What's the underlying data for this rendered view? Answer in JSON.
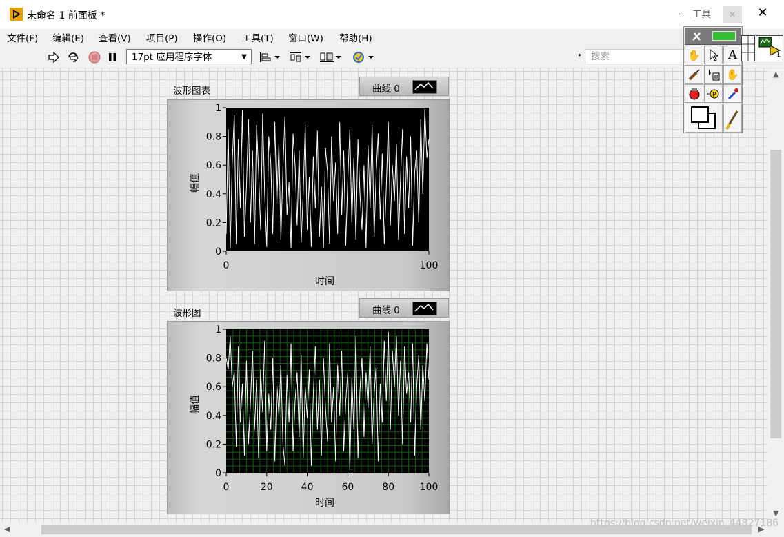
{
  "window": {
    "title": "未命名 1 前面板 *",
    "minimize_glyph": "–",
    "close_glyph": "✕"
  },
  "menu": [
    "文件(F)",
    "编辑(E)",
    "查看(V)",
    "项目(P)",
    "操作(O)",
    "工具(T)",
    "窗口(W)",
    "帮助(H)"
  ],
  "toolbar": {
    "font": "17pt 应用程序字体",
    "search_placeholder": "搜索"
  },
  "tools_palette": {
    "title": "工具",
    "close_glyph": "✕",
    "icons": [
      "auto-tool-icon",
      "operate-value-icon",
      "position-size-icon",
      "edit-text-icon",
      "connect-wire-icon",
      "object-shortcut-menu-icon",
      "scroll-window-icon",
      "breakpoint-icon",
      "probe-icon",
      "get-color-icon",
      "set-color-icon",
      "paintbrush-icon"
    ]
  },
  "vi_icon": {
    "connector_number": "1"
  },
  "charts": [
    {
      "label": "波形图表",
      "legend": "曲线 0",
      "plot_bg": "#000000",
      "grid": false,
      "xlabel": "时间",
      "ylabel": "幅值"
    },
    {
      "label": "波形图",
      "legend": "曲线 0",
      "plot_bg": "#000000",
      "grid": true,
      "grid_color": "#0b5c0b",
      "xlabel": "时间",
      "ylabel": "幅值"
    }
  ],
  "chart_data": [
    {
      "type": "line",
      "x": [
        0,
        1,
        2,
        3,
        4,
        5,
        6,
        7,
        8,
        9,
        10,
        11,
        12,
        13,
        14,
        15,
        16,
        17,
        18,
        19,
        20,
        21,
        22,
        23,
        24,
        25,
        26,
        27,
        28,
        29,
        30,
        31,
        32,
        33,
        34,
        35,
        36,
        37,
        38,
        39,
        40,
        41,
        42,
        43,
        44,
        45,
        46,
        47,
        48,
        49,
        50,
        51,
        52,
        53,
        54,
        55,
        56,
        57,
        58,
        59,
        60,
        61,
        62,
        63,
        64,
        65,
        66,
        67,
        68,
        69,
        70,
        71,
        72,
        73,
        74,
        75,
        76,
        77,
        78,
        79,
        80,
        81,
        82,
        83,
        84,
        85,
        86,
        87,
        88,
        89,
        90,
        91,
        92,
        93,
        94,
        95,
        96,
        97,
        98,
        99,
        100
      ],
      "series": [
        {
          "values": [
            0.12,
            0.85,
            0.02,
            0.62,
            0.95,
            0.05,
            0.78,
            0.3,
            0.98,
            0.1,
            0.45,
            0.92,
            0.2,
            0.7,
            0.05,
            0.88,
            0.55,
            0.15,
            0.96,
            0.4,
            0.03,
            0.8,
            0.62,
            0.12,
            0.9,
            0.33,
            0.75,
            0.08,
            0.58,
            0.94,
            0.25,
            0.48,
            0.02,
            0.82,
            0.6,
            0.18,
            0.7,
            0.06,
            0.4,
            0.88,
            0.15,
            0.52,
            0.03,
            0.66,
            0.3,
            0.84,
            0.1,
            0.45,
            0.02,
            0.72,
            0.55,
            0.05,
            0.8,
            0.35,
            0.62,
            0.12,
            0.9,
            0.25,
            0.7,
            0.04,
            0.5,
            0.85,
            0.2,
            0.65,
            0.08,
            0.78,
            0.4,
            0.15,
            0.6,
            0.02,
            0.74,
            0.3,
            0.88,
            0.1,
            0.55,
            0.82,
            0.22,
            0.68,
            0.05,
            0.45,
            0.9,
            0.18,
            0.6,
            0.35,
            0.75,
            0.08,
            0.5,
            0.85,
            0.12,
            0.66,
            0.3,
            0.8,
            0.04,
            0.55,
            0.7,
            0.2,
            0.92,
            0.4,
            0.99,
            0.65,
            0.78
          ]
        }
      ],
      "xlim": [
        0,
        100
      ],
      "ylim": [
        0,
        1
      ],
      "xticks": [
        "0",
        "100"
      ],
      "yticks": [
        "0",
        "0.2",
        "0.4",
        "0.6",
        "0.8",
        "1"
      ],
      "xlabel": "时间",
      "ylabel": "幅值",
      "grid": false
    },
    {
      "type": "line",
      "x": [
        0,
        1,
        2,
        3,
        4,
        5,
        6,
        7,
        8,
        9,
        10,
        11,
        12,
        13,
        14,
        15,
        16,
        17,
        18,
        19,
        20,
        21,
        22,
        23,
        24,
        25,
        26,
        27,
        28,
        29,
        30,
        31,
        32,
        33,
        34,
        35,
        36,
        37,
        38,
        39,
        40,
        41,
        42,
        43,
        44,
        45,
        46,
        47,
        48,
        49,
        50,
        51,
        52,
        53,
        54,
        55,
        56,
        57,
        58,
        59,
        60,
        61,
        62,
        63,
        64,
        65,
        66,
        67,
        68,
        69,
        70,
        71,
        72,
        73,
        74,
        75,
        76,
        77,
        78,
        79,
        80,
        81,
        82,
        83,
        84,
        85,
        86,
        87,
        88,
        89,
        90,
        91,
        92,
        93,
        94,
        95,
        96,
        97,
        98,
        99,
        100
      ],
      "series": [
        {
          "values": [
            0.8,
            0.72,
            0.95,
            0.6,
            0.7,
            0.18,
            0.88,
            0.35,
            0.62,
            0.12,
            0.78,
            0.2,
            0.5,
            0.85,
            0.3,
            0.65,
            0.1,
            0.72,
            0.42,
            0.92,
            0.15,
            0.55,
            0.3,
            0.8,
            0.08,
            0.62,
            0.4,
            0.75,
            0.2,
            0.05,
            0.68,
            0.35,
            0.9,
            0.15,
            0.5,
            0.7,
            0.25,
            0.82,
            0.1,
            0.6,
            0.38,
            0.72,
            0.05,
            0.55,
            0.88,
            0.3,
            0.65,
            0.12,
            0.8,
            0.45,
            0.22,
            0.9,
            0.35,
            0.6,
            0.08,
            0.75,
            0.4,
            0.85,
            0.15,
            0.5,
            0.7,
            0.02,
            0.66,
            0.3,
            0.95,
            0.1,
            0.58,
            0.8,
            0.25,
            0.7,
            0.45,
            0.88,
            0.2,
            0.55,
            0.75,
            0.08,
            0.62,
            0.35,
            0.92,
            0.5,
            0.98,
            0.3,
            0.85,
            0.6,
            0.95,
            0.4,
            0.78,
            0.2,
            0.88,
            0.55,
            0.7,
            0.35,
            0.9,
            0.12,
            0.6,
            0.82,
            0.3,
            0.75,
            0.5,
            0.9,
            0.65
          ]
        }
      ],
      "xlim": [
        0,
        100
      ],
      "ylim": [
        0,
        1
      ],
      "xticks": [
        "0",
        "20",
        "40",
        "60",
        "80",
        "100"
      ],
      "yticks": [
        "0",
        "0.2",
        "0.4",
        "0.6",
        "0.8",
        "1"
      ],
      "xlabel": "时间",
      "ylabel": "幅值",
      "grid": true
    }
  ],
  "watermark": "https://blog.csdn.net/weixin_44827186"
}
